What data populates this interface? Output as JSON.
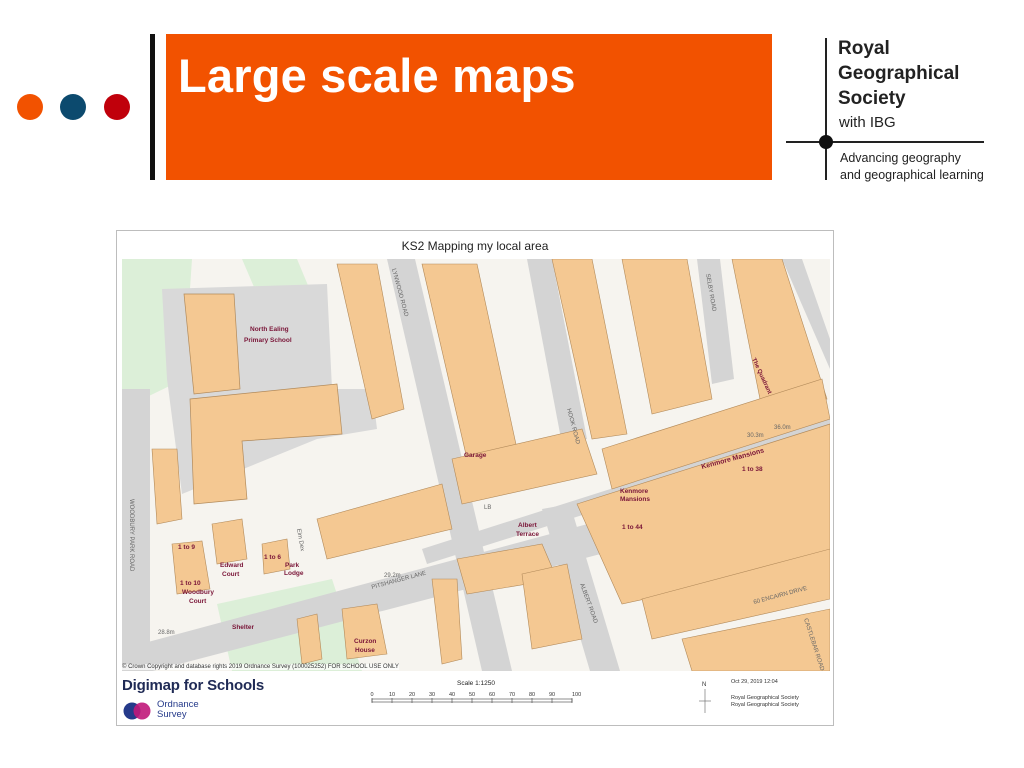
{
  "slide": {
    "title": "Large scale maps",
    "dot_colors": [
      "#f25200",
      "#0c4a6e",
      "#c0000b"
    ],
    "accent_color": "#f25200"
  },
  "rgs_logo": {
    "name_line1": "Royal",
    "name_line2": "Geographical",
    "name_line3": "Society",
    "with": "with",
    "ibg": "IBG",
    "tagline_line1": "Advancing geography",
    "tagline_line2": "and geographical learning"
  },
  "map": {
    "title": "KS2 Mapping my local area",
    "labels": {
      "school": "North Ealing",
      "school2": "Primary School",
      "pitshanger": "PITSHANGER LANE",
      "kenmore": "Kenmore Mansions",
      "kenmore2": "Kenmore",
      "kenmore3": "Mansions",
      "albert": "Albert",
      "albert2": "Terrace",
      "albert_road": "ALBERT ROAD",
      "edward": "Edward",
      "edward2": "Court",
      "park": "Park",
      "park2": "Lodge",
      "woodbury": "Woodbury",
      "woodbury2": "Court",
      "curzon": "Curzon",
      "curzon2": "House",
      "shelter": "Shelter",
      "garage": "Garage",
      "lb": "LB",
      "elm": "Elm Dex",
      "quadrant": "The Quadrant",
      "woodbury_road": "WOODBURY PARK ROAD",
      "lynwood": "LYNWOOD ROAD",
      "selby": "SELBY ROAD",
      "castlebar": "CASTLEBAR ROAD",
      "hook": "HOOK ROAD",
      "plot_num": "60 ENCAIRN DRIVE",
      "num_1to9": "1 to 9",
      "num_1to6": "1 to 6",
      "num_1to10": "1 to 10",
      "num_1to44": "1 to 44",
      "num_1to38": "1 to 38",
      "spot1": "29.2m",
      "spot2": "28.8m",
      "spot3": "30.3m",
      "spot4": "36.0m"
    },
    "copyright": "© Crown Copyright and database rights 2019 Ordnance Survey (100025252) FOR SCHOOL USE ONLY",
    "brand": "Digimap for Schools",
    "os_line1": "Ordnance",
    "os_line2": "Survey",
    "scale": "Scale 1:1250",
    "scale_ticks": [
      "0",
      "10",
      "20",
      "30",
      "40",
      "50",
      "60",
      "70",
      "80",
      "90",
      "100 m"
    ],
    "north": "N",
    "date": "Oct 29, 2019 12:04",
    "owner_line1": "Royal Geographical Society",
    "owner_line2": "Royal Geographical Society"
  }
}
